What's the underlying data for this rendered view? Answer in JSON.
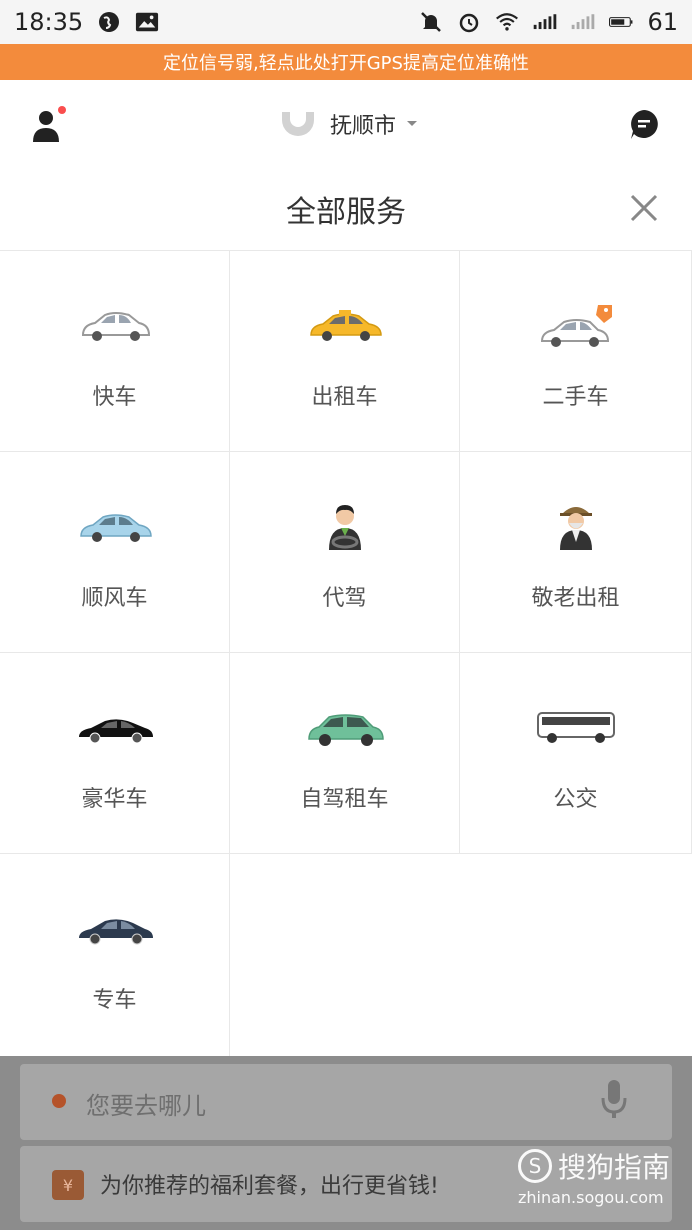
{
  "status_bar": {
    "time": "18:35",
    "battery": "61"
  },
  "gps_notice": "定位信号弱,轻点此处打开GPS提高定位准确性",
  "header": {
    "city": "抚顺市"
  },
  "sheet": {
    "title": "全部服务",
    "services": [
      {
        "label": "快车",
        "icon": "white-car-icon"
      },
      {
        "label": "出租车",
        "icon": "yellow-taxi-icon"
      },
      {
        "label": "二手车",
        "icon": "used-car-tag-icon"
      },
      {
        "label": "顺风车",
        "icon": "light-blue-car-icon"
      },
      {
        "label": "代驾",
        "icon": "designated-driver-icon"
      },
      {
        "label": "敬老出租",
        "icon": "elderly-man-icon"
      },
      {
        "label": "豪华车",
        "icon": "black-luxury-car-icon"
      },
      {
        "label": "自驾租车",
        "icon": "green-suv-icon"
      },
      {
        "label": "公交",
        "icon": "bus-icon"
      },
      {
        "label": "专车",
        "icon": "dark-blue-sedan-icon"
      }
    ]
  },
  "destination_placeholder": "您要去哪儿",
  "promo_text": "为你推荐的福利套餐，出行更省钱!",
  "promo_icon_glyph": "¥",
  "watermark": {
    "brand": "搜狗指南",
    "url": "zhinan.sogou.com"
  },
  "colors": {
    "accent": "#f38b3c",
    "badge": "#fa4e4e"
  }
}
